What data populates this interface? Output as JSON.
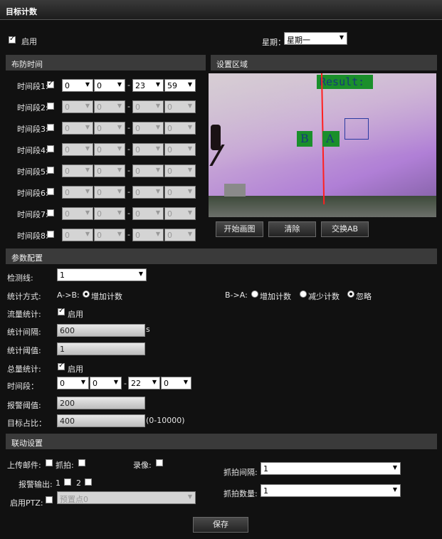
{
  "window": {
    "title": "目标计数"
  },
  "top": {
    "enable_label": "启用",
    "weekday_label": "星期：",
    "weekday_value": "星期一"
  },
  "schedule": {
    "title": "布防时间",
    "periods": [
      {
        "label": "时间段1:",
        "checked": true,
        "sh": "0",
        "sm": "0",
        "eh": "23",
        "em": "59"
      },
      {
        "label": "时间段2:",
        "checked": false,
        "sh": "0",
        "sm": "0",
        "eh": "0",
        "em": "0"
      },
      {
        "label": "时间段3:",
        "checked": false,
        "sh": "0",
        "sm": "0",
        "eh": "0",
        "em": "0"
      },
      {
        "label": "时间段4:",
        "checked": false,
        "sh": "0",
        "sm": "0",
        "eh": "0",
        "em": "0"
      },
      {
        "label": "时间段5:",
        "checked": false,
        "sh": "0",
        "sm": "0",
        "eh": "0",
        "em": "0"
      },
      {
        "label": "时间段6:",
        "checked": false,
        "sh": "0",
        "sm": "0",
        "eh": "0",
        "em": "0"
      },
      {
        "label": "时间段7:",
        "checked": false,
        "sh": "0",
        "sm": "0",
        "eh": "0",
        "em": "0"
      },
      {
        "label": "时间段8:",
        "checked": false,
        "sh": "0",
        "sm": "0",
        "eh": "0",
        "em": "0"
      }
    ],
    "dash": "-"
  },
  "region": {
    "title": "设置区域",
    "overlay_result": "Result:",
    "overlay_b": "B",
    "overlay_a": "A",
    "btn_start": "开始画图",
    "btn_clear": "清除",
    "btn_swap": "交换AB"
  },
  "params": {
    "title": "参数配置",
    "detect_line_label": "检测线:",
    "detect_line_value": "1",
    "stat_mode_label": "统计方式:",
    "ab_label": "A->B:",
    "ab_option": "增加计数",
    "ba_label": "B->A:",
    "ba_options": [
      "增加计数",
      "减少计数",
      "忽略"
    ],
    "flow_label": "流量统计:",
    "enable_label": "启用",
    "interval_label": "统计间隔:",
    "interval_value": "600",
    "interval_unit": "s",
    "threshold_label": "统计阈值:",
    "threshold_value": "1",
    "total_label": "总量统计:",
    "period_label": "时间段：",
    "period_sh": "0",
    "period_sm": "0",
    "period_eh": "22",
    "period_em": "0",
    "alarm_label": "报警阈值:",
    "alarm_value": "200",
    "ratio_label": "目标占比：",
    "ratio_value": "400",
    "ratio_range": "(0-10000)"
  },
  "linkage": {
    "title": "联动设置",
    "upload_mail": "上传邮件:",
    "snapshot": "抓拍:",
    "record": "录像:",
    "alarm_out": "报警输出:",
    "out1": "1",
    "out2": "2",
    "ptz_label": "启用PTZ:",
    "preset_value": "预置点0",
    "snap_interval_label": "抓拍间隔:",
    "snap_interval_value": "1",
    "snap_count_label": "抓拍数量:",
    "snap_count_value": "1"
  },
  "save_label": "保存",
  "colors": {
    "accent_green": "#1a8f2b",
    "line_red": "#ff2020",
    "section_bg": "#3a3a3a"
  }
}
